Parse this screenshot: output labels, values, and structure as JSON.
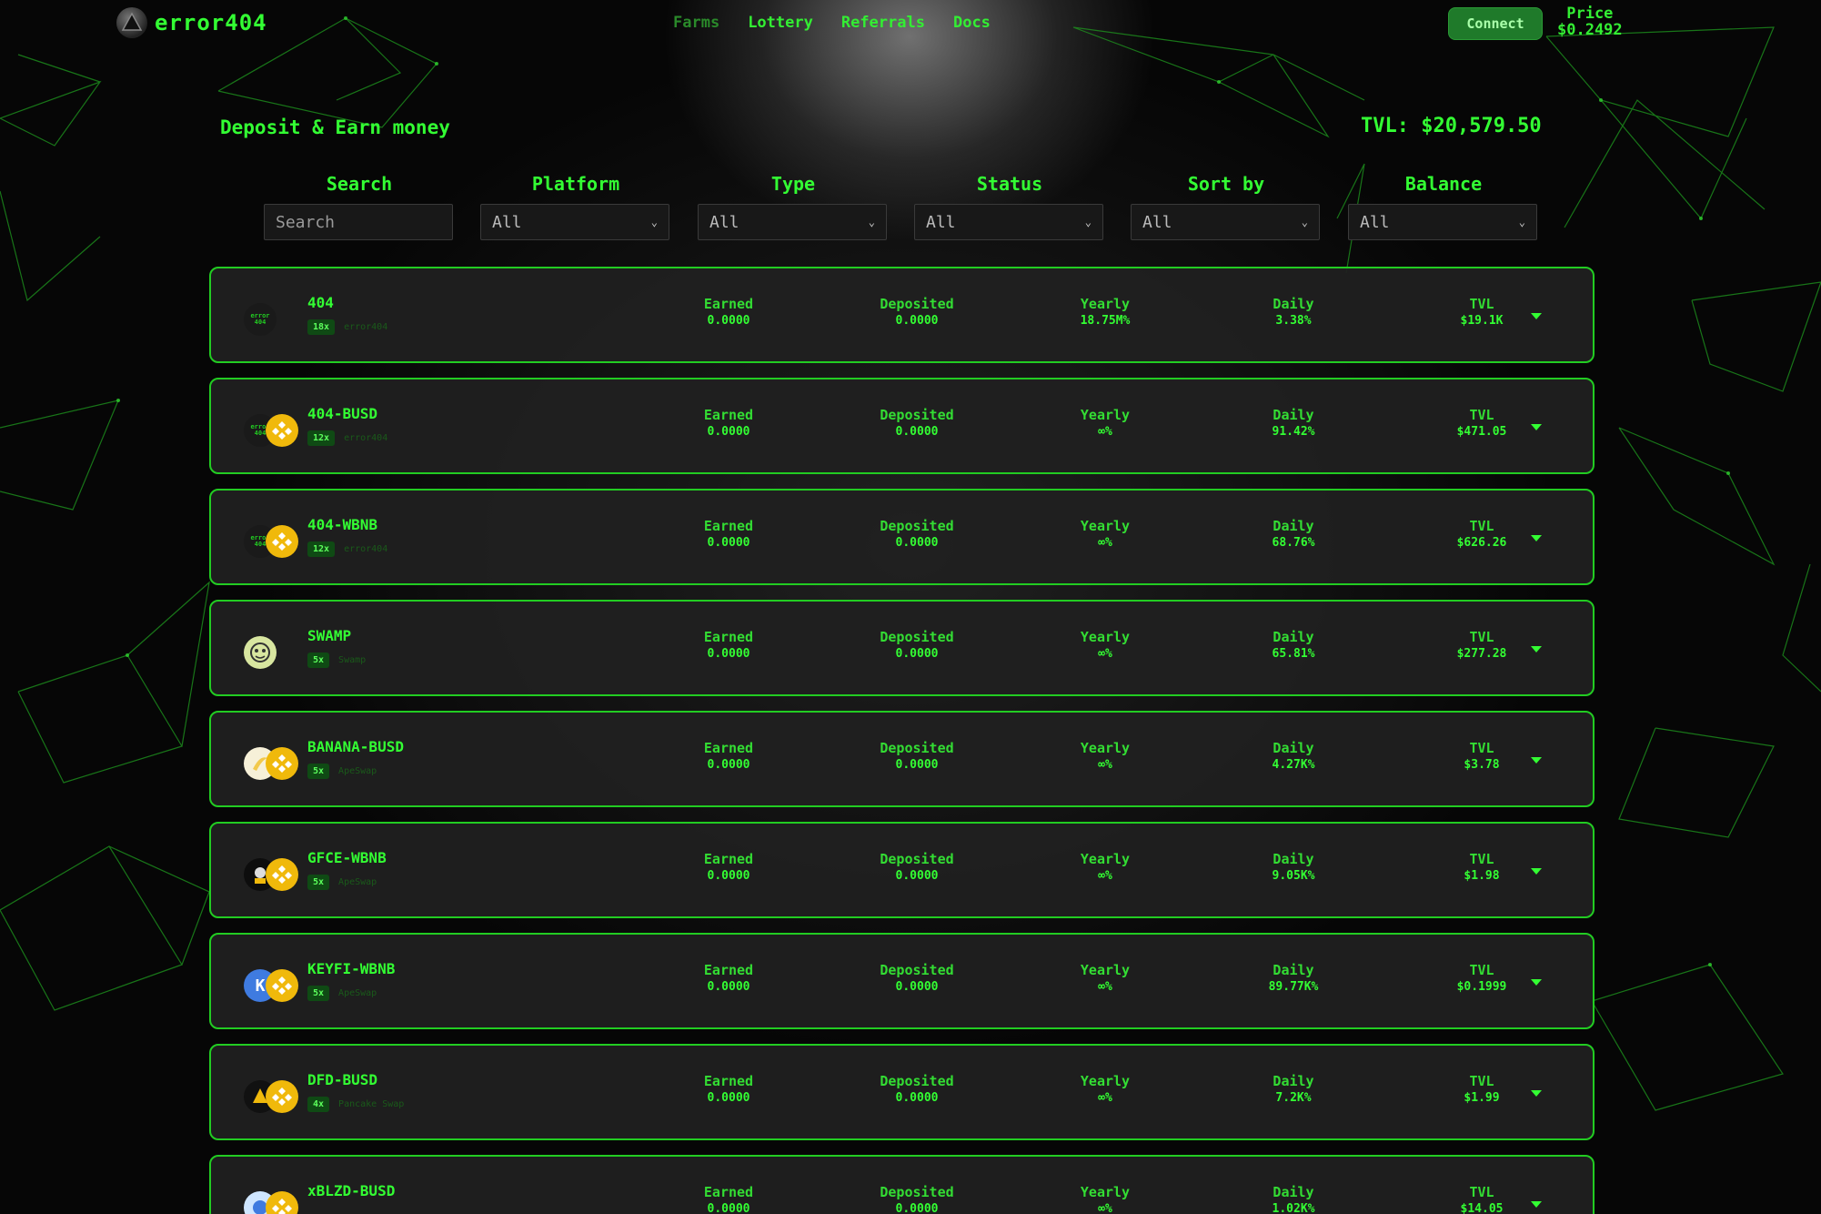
{
  "header": {
    "logo_text": "error404",
    "nav": [
      {
        "label": "Farms",
        "active": true
      },
      {
        "label": "Lottery",
        "active": false
      },
      {
        "label": "Referrals",
        "active": false
      },
      {
        "label": "Docs",
        "active": false
      }
    ],
    "connect_label": "Connect",
    "price_label": "Price",
    "price_value": "$0.2492"
  },
  "page": {
    "title": "Deposit & Earn money",
    "tvl_total": "TVL: $20,579.50"
  },
  "filters": {
    "search": {
      "label": "Search",
      "placeholder": "Search",
      "value": ""
    },
    "platform": {
      "label": "Platform",
      "value": "All"
    },
    "type": {
      "label": "Type",
      "value": "All"
    },
    "status": {
      "label": "Status",
      "value": "All"
    },
    "sort_by": {
      "label": "Sort by",
      "value": "All"
    },
    "balance": {
      "label": "Balance",
      "value": "All"
    }
  },
  "stat_labels": {
    "earned": "Earned",
    "deposited": "Deposited",
    "yearly": "Yearly",
    "daily": "Daily",
    "tvl": "TVL"
  },
  "farms": [
    {
      "name": "404",
      "multiplier": "18x",
      "platform": "error404",
      "earned": "0.0000",
      "deposited": "0.0000",
      "yearly": "18.75M%",
      "daily": "3.38%",
      "tvl": "$19.1K",
      "icons": [
        "error404-token-icon"
      ]
    },
    {
      "name": "404-BUSD",
      "multiplier": "12x",
      "platform": "error404",
      "earned": "0.0000",
      "deposited": "0.0000",
      "yearly": "∞%",
      "daily": "91.42%",
      "tvl": "$471.05",
      "icons": [
        "error404-token-icon",
        "busd-token-icon"
      ]
    },
    {
      "name": "404-WBNB",
      "multiplier": "12x",
      "platform": "error404",
      "earned": "0.0000",
      "deposited": "0.0000",
      "yearly": "∞%",
      "daily": "68.76%",
      "tvl": "$626.26",
      "icons": [
        "error404-token-icon",
        "bnb-token-icon"
      ]
    },
    {
      "name": "SWAMP",
      "multiplier": "5x",
      "platform": "Swamp",
      "earned": "0.0000",
      "deposited": "0.0000",
      "yearly": "∞%",
      "daily": "65.81%",
      "tvl": "$277.28",
      "icons": [
        "swamp-token-icon"
      ]
    },
    {
      "name": "BANANA-BUSD",
      "multiplier": "5x",
      "platform": "ApeSwap",
      "earned": "0.0000",
      "deposited": "0.0000",
      "yearly": "∞%",
      "daily": "4.27K%",
      "tvl": "$3.78",
      "icons": [
        "banana-token-icon",
        "busd-token-icon"
      ]
    },
    {
      "name": "GFCE-WBNB",
      "multiplier": "5x",
      "platform": "ApeSwap",
      "earned": "0.0000",
      "deposited": "0.0000",
      "yearly": "∞%",
      "daily": "9.05K%",
      "tvl": "$1.98",
      "icons": [
        "gfce-token-icon",
        "bnb-token-icon"
      ]
    },
    {
      "name": "KEYFI-WBNB",
      "multiplier": "5x",
      "platform": "ApeSwap",
      "earned": "0.0000",
      "deposited": "0.0000",
      "yearly": "∞%",
      "daily": "89.77K%",
      "tvl": "$0.1999",
      "icons": [
        "keyfi-token-icon",
        "bnb-token-icon"
      ]
    },
    {
      "name": "DFD-BUSD",
      "multiplier": "4x",
      "platform": "Pancake Swap",
      "earned": "0.0000",
      "deposited": "0.0000",
      "yearly": "∞%",
      "daily": "7.2K%",
      "tvl": "$1.99",
      "icons": [
        "dfd-token-icon",
        "busd-token-icon"
      ]
    },
    {
      "name": "xBLZD-BUSD",
      "multiplier": "",
      "platform": "",
      "earned": "0.0000",
      "deposited": "0.0000",
      "yearly": "∞%",
      "daily": "1.02K%",
      "tvl": "$14.05",
      "icons": [
        "blzd-token-icon",
        "busd-token-icon"
      ]
    }
  ]
}
